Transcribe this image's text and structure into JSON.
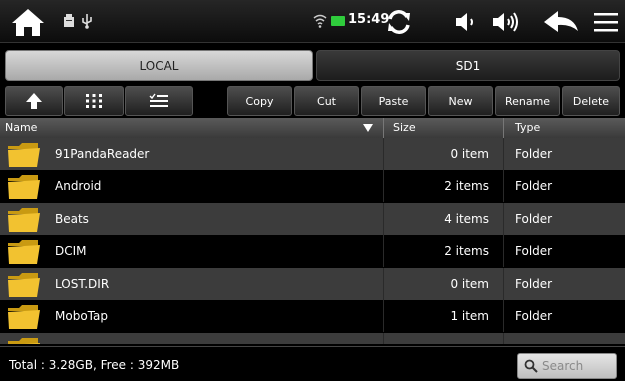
{
  "statusbar": {
    "time": "15:49",
    "icons": [
      "home-icon",
      "usb-notification-icon",
      "usb-debug-icon",
      "wifi-icon",
      "battery-icon",
      "refresh-icon",
      "volume-down-icon",
      "volume-up-icon",
      "back-icon",
      "menu-icon"
    ]
  },
  "tabs": [
    {
      "label": "LOCAL",
      "selected": true
    },
    {
      "label": "SD1",
      "selected": false
    }
  ],
  "toolbar": {
    "copy": "Copy",
    "cut": "Cut",
    "paste": "Paste",
    "new": "New",
    "rename": "Rename",
    "delete": "Delete"
  },
  "columns": {
    "name": "Name",
    "size": "Size",
    "type": "Type"
  },
  "files": [
    {
      "name": "91PandaReader",
      "size": "0 item",
      "type": "Folder"
    },
    {
      "name": "Android",
      "size": "2 items",
      "type": "Folder"
    },
    {
      "name": "Beats",
      "size": "4 items",
      "type": "Folder"
    },
    {
      "name": "DCIM",
      "size": "2 items",
      "type": "Folder"
    },
    {
      "name": "LOST.DIR",
      "size": "0 item",
      "type": "Folder"
    },
    {
      "name": "MoboTap",
      "size": "1 item",
      "type": "Folder"
    },
    {
      "name": "",
      "size": "",
      "type": ""
    }
  ],
  "footer": {
    "total": "Total : 3.28GB, Free : 392MB",
    "search_placeholder": "Search"
  },
  "colors": {
    "folder": "#f2c230",
    "row_alt": "#3c3c3c",
    "battery": "#2fcc3c"
  }
}
